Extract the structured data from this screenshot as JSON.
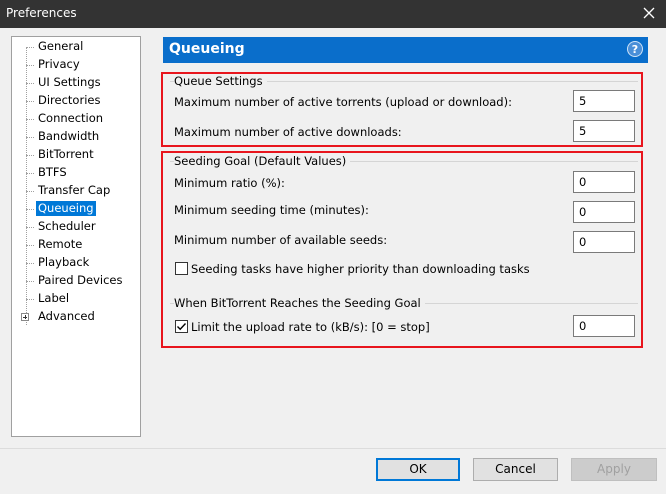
{
  "window": {
    "title": "Preferences"
  },
  "sidebar": {
    "items": [
      {
        "label": "General"
      },
      {
        "label": "Privacy"
      },
      {
        "label": "UI Settings"
      },
      {
        "label": "Directories"
      },
      {
        "label": "Connection"
      },
      {
        "label": "Bandwidth"
      },
      {
        "label": "BitTorrent"
      },
      {
        "label": "BTFS"
      },
      {
        "label": "Transfer Cap"
      },
      {
        "label": "Queueing",
        "selected": true
      },
      {
        "label": "Scheduler"
      },
      {
        "label": "Remote"
      },
      {
        "label": "Playback"
      },
      {
        "label": "Paired Devices"
      },
      {
        "label": "Label"
      },
      {
        "label": "Advanced",
        "expandable": true
      }
    ]
  },
  "header": {
    "title": "Queueing",
    "help": "?"
  },
  "queue": {
    "title": "Queue Settings",
    "max_active_torrents": {
      "label": "Maximum number of active torrents (upload or download):",
      "value": "5"
    },
    "max_active_downloads": {
      "label": "Maximum number of active downloads:",
      "value": "5"
    }
  },
  "seeding": {
    "title": "Seeding Goal (Default Values)",
    "min_ratio": {
      "label": "Minimum ratio (%):",
      "value": "0"
    },
    "min_seed_time": {
      "label": "Minimum seeding time (minutes):",
      "value": "0"
    },
    "min_seeds": {
      "label": "Minimum number of available seeds:",
      "value": "0"
    },
    "priority": {
      "label": "Seeding tasks have higher priority than downloading tasks",
      "checked": false
    }
  },
  "goal": {
    "title": "When BitTorrent Reaches the Seeding Goal",
    "limit_upload": {
      "label": "Limit the upload rate to (kB/s): [0 = stop]",
      "checked": true,
      "value": "0"
    }
  },
  "footer": {
    "ok": "OK",
    "cancel": "Cancel",
    "apply": "Apply"
  },
  "colors": {
    "accent": "#0a6ecb",
    "highlight": "#e8151d",
    "selection": "#0078d7",
    "titlebar": "#333333"
  }
}
